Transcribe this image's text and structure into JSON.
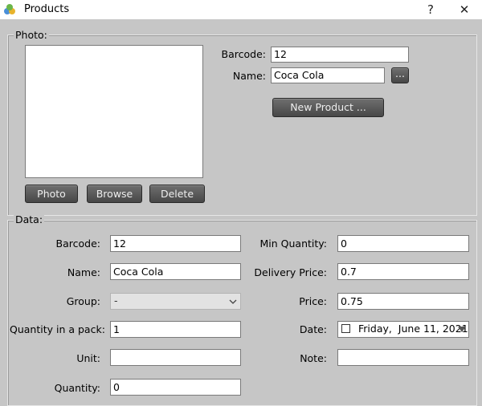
{
  "window": {
    "title": "Products",
    "help_glyph": "?",
    "close_glyph": "✕"
  },
  "photo_group": {
    "legend": "Photo:",
    "barcode_label": "Barcode:",
    "barcode_value": "12",
    "name_label": "Name:",
    "name_value": "Coca Cola",
    "ellipsis_label": "...",
    "new_product_label": "New Product ...",
    "buttons": {
      "photo": "Photo",
      "browse": "Browse",
      "delete": "Delete"
    }
  },
  "data_group": {
    "legend": "Data:",
    "barcode_label": "Barcode:",
    "barcode_value": "12",
    "name_label": "Name:",
    "name_value": "Coca Cola",
    "group_label": "Group:",
    "group_value": "-",
    "qty_pack_label": "Quantity in a pack:",
    "qty_pack_value": "1",
    "unit_label": "Unit:",
    "unit_value": "",
    "quantity_label": "Quantity:",
    "quantity_value": "0",
    "min_qty_label": "Min Quantity:",
    "min_qty_value": "0",
    "delivery_price_label": "Delivery Price:",
    "delivery_price_value": "0.7",
    "price_label": "Price:",
    "price_value": "0.75",
    "date_label": "Date:",
    "date_value": "Friday,  June 11, 2021",
    "note_label": "Note:",
    "note_value": ""
  },
  "colors": {
    "background": "#c6c6c6",
    "button": "#555555",
    "titlebar": "#ffffff"
  }
}
